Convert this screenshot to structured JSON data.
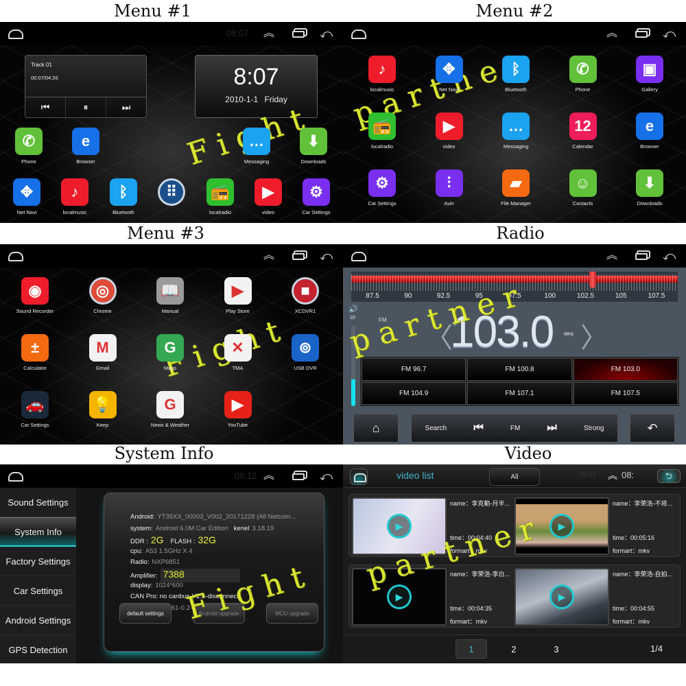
{
  "captions": {
    "menu1": "Menu #1",
    "menu2": "Menu #2",
    "menu3": "Menu #3",
    "radio": "Radio",
    "system_info": "System Info",
    "video": "Video"
  },
  "watermark": {
    "word1": "Fight",
    "word2": "partner"
  },
  "statusbar": {
    "home_icon": "home-outline-icon",
    "up_icon": "double-chevron-up-icon",
    "recent_icon": "recent-apps-icon",
    "back_icon": "back-arrow-icon",
    "up_glyph": "︽",
    "back_glyph": "⤺"
  },
  "menu1": {
    "status_time": "08:07",
    "music": {
      "track": "Track 01",
      "time": "00:07/04:26",
      "prev": "⏮",
      "pause": "⏸",
      "next": "⏭"
    },
    "clock": {
      "time": "8:07",
      "date": "2010-1-1 Friday"
    },
    "apps_row1": [
      {
        "label": "Phone",
        "glyph": "✆",
        "color": "#62c13a"
      },
      {
        "label": "Browser",
        "glyph": "e",
        "color": "#1670e8"
      },
      {
        "label": "Messaging",
        "glyph": "…",
        "color": "#1ba2f0"
      },
      {
        "label": "Downloads",
        "glyph": "⬇",
        "color": "#62c13a"
      }
    ],
    "apps_row2": [
      {
        "label": "Net Navi",
        "glyph": "✥",
        "color": "#1670e8"
      },
      {
        "label": "localmusic",
        "glyph": "♪",
        "color": "#ef1d2b"
      },
      {
        "label": "Bluetooth",
        "glyph": "ᛒ",
        "color": "#1ba2f0"
      },
      {
        "label": "",
        "glyph": "⠿",
        "color": "#1a4f8a"
      },
      {
        "label": "localradio",
        "glyph": "📻",
        "color": "#2fbf2f"
      },
      {
        "label": "video",
        "glyph": "▶",
        "color": "#ef1d2b"
      },
      {
        "label": "Car Settings",
        "glyph": "⚙",
        "color": "#7a2ff0"
      }
    ]
  },
  "menu2": {
    "apps": [
      {
        "label": "localmusic",
        "glyph": "♪",
        "color": "#ef1d2b"
      },
      {
        "label": "Net Navi",
        "glyph": "✥",
        "color": "#1670e8"
      },
      {
        "label": "Bluetooth",
        "glyph": "ᛒ",
        "color": "#1ba2f0"
      },
      {
        "label": "Phone",
        "glyph": "✆",
        "color": "#62c13a"
      },
      {
        "label": "Gallery",
        "glyph": "▣",
        "color": "#7a2ff0"
      },
      {
        "label": "localradio",
        "glyph": "📻",
        "color": "#2fbf2f"
      },
      {
        "label": "video",
        "glyph": "▶",
        "color": "#ef1d2b"
      },
      {
        "label": "Messaging",
        "glyph": "…",
        "color": "#1ba2f0"
      },
      {
        "label": "Calendar",
        "glyph": "12",
        "color": "#ef1d5a"
      },
      {
        "label": "Browser",
        "glyph": "e",
        "color": "#1670e8"
      },
      {
        "label": "Car Settings",
        "glyph": "⚙",
        "color": "#7a2ff0"
      },
      {
        "label": "Avin",
        "glyph": "⫶",
        "color": "#7a2ff0"
      },
      {
        "label": "File Manager",
        "glyph": "▰",
        "color": "#f56a10"
      },
      {
        "label": "Contacts",
        "glyph": "☺",
        "color": "#62c13a"
      },
      {
        "label": "Downloads",
        "glyph": "⬇",
        "color": "#62c13a"
      }
    ]
  },
  "menu3": {
    "apps": [
      {
        "label": "Sound Recorder",
        "glyph": "◉",
        "color": "#ef1d2b"
      },
      {
        "label": "Chrome",
        "glyph": "◎",
        "color": "#dd4b39"
      },
      {
        "label": "Manual",
        "glyph": "📖",
        "color": "#9a9a9a"
      },
      {
        "label": "Play Store",
        "glyph": "▶",
        "color": "#f2f2f2"
      },
      {
        "label": "XCDVR1",
        "glyph": "■",
        "color": "#c4222e"
      },
      {
        "label": "Calculator",
        "glyph": "±",
        "color": "#f36a10"
      },
      {
        "label": "Gmail",
        "glyph": "M",
        "color": "#f2f2f2"
      },
      {
        "label": "Maps",
        "glyph": "G",
        "color": "#34a853"
      },
      {
        "label": "TMA",
        "glyph": "✕",
        "color": "#f2f2f2"
      },
      {
        "label": "USB DVR",
        "glyph": "⊚",
        "color": "#1a64c8"
      },
      {
        "label": "Car Settings",
        "glyph": "🚗",
        "color": "#1a2a3a"
      },
      {
        "label": "Keep",
        "glyph": "💡",
        "color": "#f4b400"
      },
      {
        "label": "News & Weather",
        "glyph": "G",
        "color": "#f2f2f2"
      },
      {
        "label": "YouTube",
        "glyph": "▶",
        "color": "#e62117"
      }
    ]
  },
  "radio": {
    "scale_labels": [
      "87.5",
      "90",
      "92.5",
      "95",
      "97.5",
      "100",
      "102.5",
      "105",
      "107.5"
    ],
    "scale_min": 86,
    "scale_max": 109,
    "tuned_frequency": 103.0,
    "volume_icon": "🔊",
    "volume_value": "10",
    "volume_fraction": 0.33,
    "band": "FM",
    "frequency": "103.0",
    "unit": "MHz",
    "prev_glyph": "〈",
    "next_glyph": "〉",
    "presets": [
      "FM 96.7",
      "FM 100.8",
      "FM 103.0",
      "FM 104.9",
      "FM 107.1",
      "FM 107.5"
    ],
    "active_preset": 2,
    "controls": {
      "home_glyph": "⌂",
      "search": "Search",
      "prev_glyph": "⏮",
      "band": "FM",
      "next_glyph": "⏭",
      "strong": "Strong",
      "back_glyph": "↶"
    }
  },
  "system_info": {
    "status_time": "08:12",
    "menu": [
      "Sound Settings",
      "System Info",
      "Factory Settings",
      "Car Settings",
      "Android Settings",
      "GPS Detection"
    ],
    "active_menu": 1,
    "rows": {
      "android_label": "Android:",
      "android_value": "YT35XX_00003_V002_20171228 (All Netcom...",
      "system_label": "system:",
      "system_value": "Android 6.0M Car Edition",
      "kenel_label": "kenel",
      "kenel_value": "3.18.19",
      "ddr_label": "DDR :",
      "ddr_value": "2G",
      "flash_label": "FLASH :",
      "flash_value": "32G",
      "cpu_label": "cpu:",
      "cpu_value": "A53 1.5GHz X 4",
      "radio_label": "Radio:",
      "radio_value": "NXP6851",
      "amp_label": "Amplifier:",
      "amp_value": "7388",
      "display_label": "display:",
      "display_value": "1024*600",
      "can_label": "CAN Pro:",
      "can_value": "no canbus-V2.6-disconnect",
      "mcu_label": "MCU1:",
      "mcu_value": "HW3561-0.2-SW-1.7"
    },
    "buttons": [
      "default settings",
      "Android upgrade",
      "MCU upgrade"
    ]
  },
  "video": {
    "title": "video list",
    "filter": "All",
    "status_time": "08:11",
    "status_time2": "08:",
    "back_glyph": "⮌",
    "play_glyph": "▶",
    "items": [
      {
        "name": "name：李克勤-月半...",
        "time": "time：00:04:40",
        "format": "formart：mkv"
      },
      {
        "name": "name：李荣浩-不将...",
        "time": "time：00:05:16",
        "format": "formart：mkv"
      },
      {
        "name": "name：李荣浩-李白...",
        "time": "time：00:04:35",
        "format": "formart：mkv"
      },
      {
        "name": "name：李荣浩-自拍...",
        "time": "time：00:04:55",
        "format": "formart：mkv"
      }
    ],
    "pages": [
      "1",
      "2",
      "3"
    ],
    "active_page": 0,
    "page_count": "1/4"
  }
}
